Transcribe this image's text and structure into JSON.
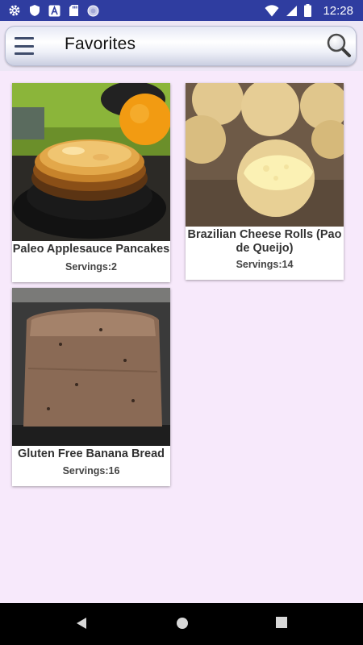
{
  "status_bar": {
    "time": "12:28",
    "left_icons": [
      "gear-icon",
      "shield-icon",
      "a-box-icon",
      "sd-card-icon",
      "circle-icon"
    ],
    "right_icons": [
      "wifi-icon",
      "signal-icon",
      "battery-icon"
    ]
  },
  "app_bar": {
    "title": "Favorites",
    "menu_icon": "hamburger-menu-icon",
    "search_icon": "search-icon"
  },
  "recipes": [
    {
      "title": "Paleo Applesauce Pancakes",
      "servings": "Servings:2",
      "image": "pancakes-photo"
    },
    {
      "title": "Brazilian Cheese Rolls (Pao de Queijo)",
      "servings": "Servings:14",
      "image": "cheese-rolls-photo"
    },
    {
      "title": "Gluten Free Banana Bread",
      "servings": "Servings:16",
      "image": "banana-bread-photo"
    }
  ],
  "nav_bar": {
    "icons": [
      "back-icon",
      "home-icon",
      "recents-icon"
    ]
  },
  "colors": {
    "status_bar": "#2f3da0",
    "background": "#f7e9fb",
    "title_text": "#111111"
  }
}
